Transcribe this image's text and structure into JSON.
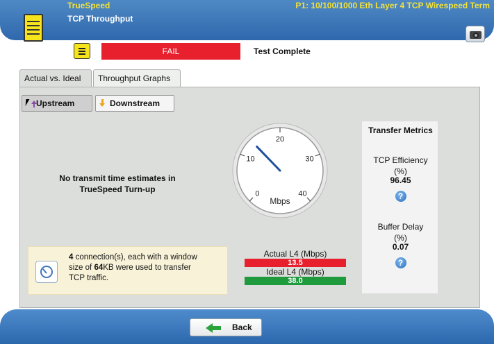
{
  "header": {
    "app_title": "TrueSpeed",
    "port_title": "P1: 10/100/1000 Eth Layer 4 TCP Wirespeed Term",
    "sub_title": "TCP Throughput"
  },
  "status": {
    "result": "FAIL",
    "text": "Test Complete",
    "result_color": "#e8202d"
  },
  "tabs": [
    {
      "label": "Actual vs. Ideal",
      "active": true
    },
    {
      "label": "Throughput Graphs",
      "active": false
    }
  ],
  "direction": {
    "upstream_label": "Upstream",
    "downstream_label": "Downstream",
    "selected": "Upstream"
  },
  "estimate_message": {
    "line1": "No transmit time estimates in",
    "line2": "TrueSpeed Turn-up"
  },
  "info": {
    "connections": "4",
    "part1": " connection(s), each with a window",
    "part2": "size of ",
    "window_size": "64",
    "part3": "KB were used to transfer",
    "part4": "TCP traffic."
  },
  "gauge": {
    "unit": "Mbps",
    "ticks": [
      "0",
      "10",
      "20",
      "30",
      "40"
    ],
    "min": 0,
    "max": 40,
    "value": 13.5
  },
  "readouts": {
    "actual_label": "Actual L4 (Mbps)",
    "actual_value": "13.5",
    "actual_color": "#e8202d",
    "ideal_label": "Ideal L4 (Mbps)",
    "ideal_value": "38.0",
    "ideal_color": "#1f9a3d"
  },
  "metrics": {
    "title": "Transfer Metrics",
    "tcp_efficiency_label": "TCP Efficiency",
    "tcp_efficiency_unit": "(%)",
    "tcp_efficiency_value": "96.45",
    "buffer_delay_label": "Buffer Delay",
    "buffer_delay_unit": "(%)",
    "buffer_delay_value": "0.07",
    "help_glyph": "?"
  },
  "footer": {
    "back_label": "Back"
  }
}
